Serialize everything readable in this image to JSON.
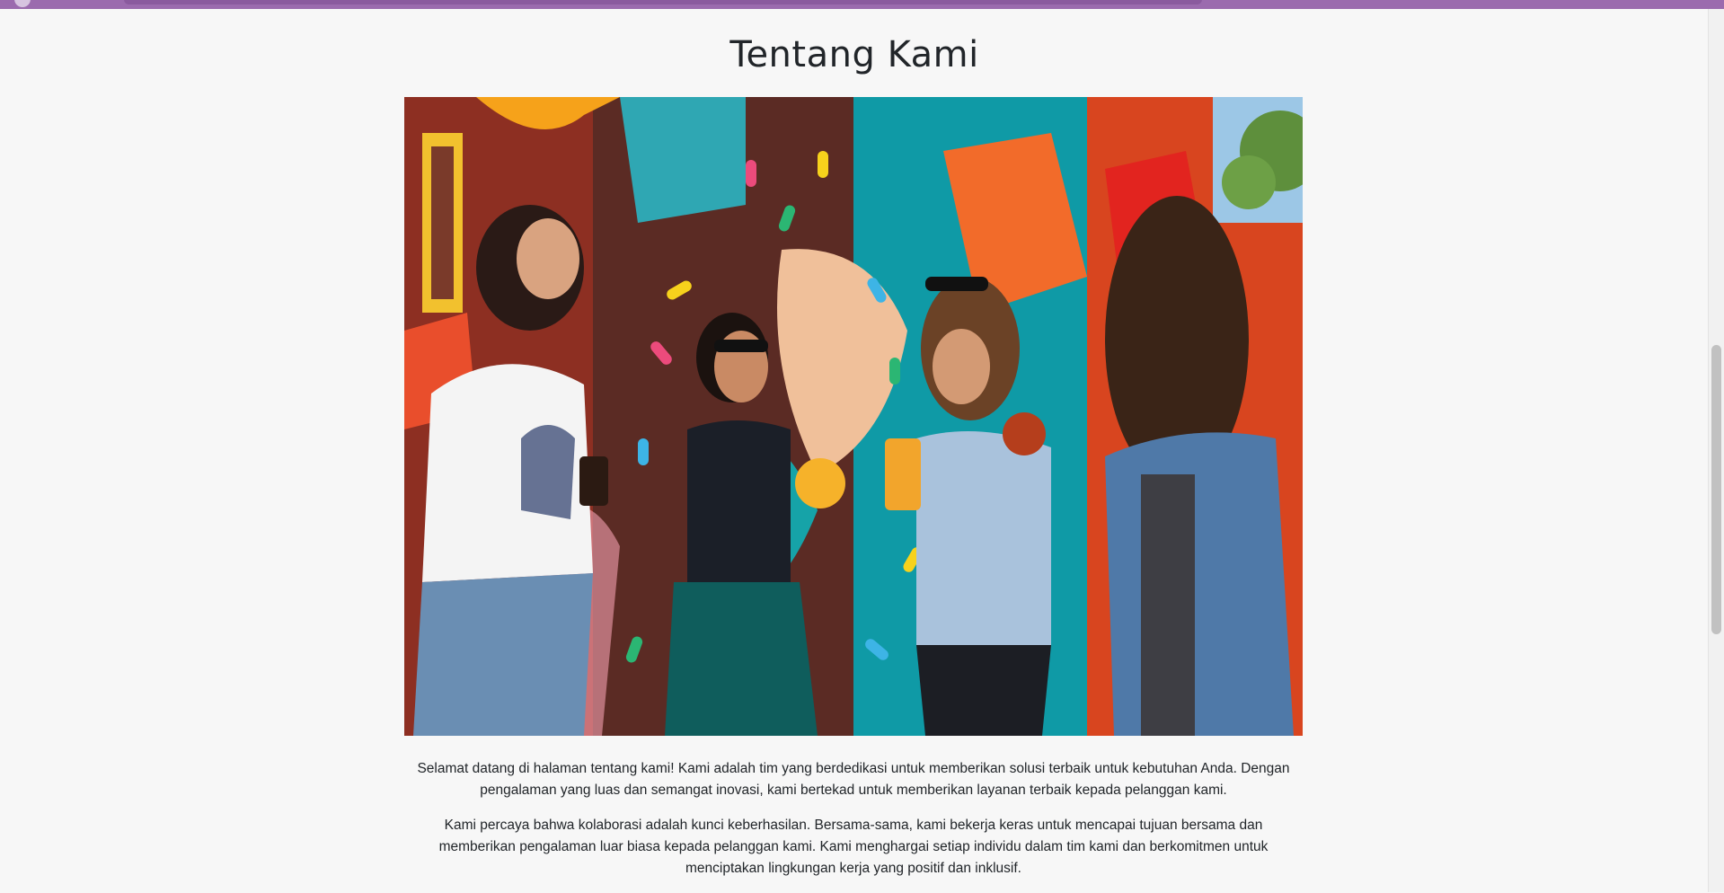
{
  "page": {
    "title": "Tentang Kami",
    "hero_image_alt": "Empat wanita tertawa sambil memegang minuman di depan mural warna-warni",
    "paragraphs": [
      "Selamat datang di halaman tentang kami! Kami adalah tim yang berdedikasi untuk memberikan solusi terbaik untuk kebutuhan Anda. Dengan pengalaman yang luas dan semangat inovasi, kami bertekad untuk memberikan layanan terbaik kepada pelanggan kami.",
      "Kami percaya bahwa kolaborasi adalah kunci keberhasilan. Bersama-sama, kami bekerja keras untuk mencapai tujuan bersama dan memberikan pengalaman luar biasa kepada pelanggan kami. Kami menghargai setiap individu dalam tim kami dan berkomitmen untuk menciptakan lingkungan kerja yang positif dan inklusif."
    ]
  },
  "theme": {
    "navbar_color": "#9b6bae",
    "background": "#f7f7f7",
    "text_color": "#212529"
  }
}
